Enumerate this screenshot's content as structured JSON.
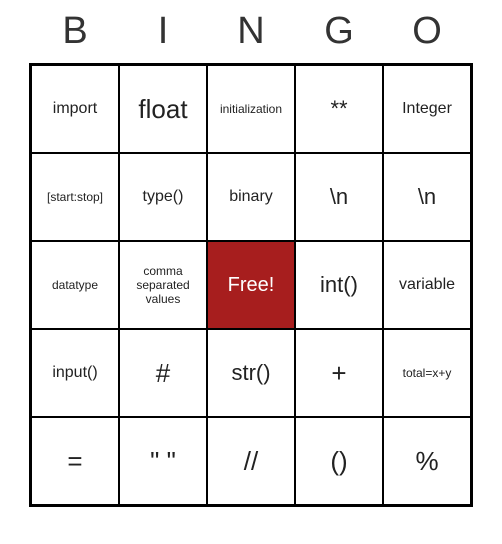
{
  "header": [
    "B",
    "I",
    "N",
    "G",
    "O"
  ],
  "cells": [
    {
      "text": "import",
      "size": "medium"
    },
    {
      "text": "float",
      "size": "xlarge"
    },
    {
      "text": "initialization",
      "size": "small"
    },
    {
      "text": "**",
      "size": "large"
    },
    {
      "text": "Integer",
      "size": "medium"
    },
    {
      "text": "[start:stop]",
      "size": "small"
    },
    {
      "text": "type()",
      "size": "medium"
    },
    {
      "text": "binary",
      "size": "medium"
    },
    {
      "text": "\\n",
      "size": "large"
    },
    {
      "text": "\\n",
      "size": "large"
    },
    {
      "text": "datatype",
      "size": "small"
    },
    {
      "text": "comma separated values",
      "size": "small"
    },
    {
      "text": "Free!",
      "size": "large",
      "free": true
    },
    {
      "text": "int()",
      "size": "large"
    },
    {
      "text": "variable",
      "size": "medium"
    },
    {
      "text": "input()",
      "size": "medium"
    },
    {
      "text": "#",
      "size": "xlarge"
    },
    {
      "text": "str()",
      "size": "large"
    },
    {
      "text": "+",
      "size": "xlarge"
    },
    {
      "text": "total=x+y",
      "size": "small"
    },
    {
      "text": "=",
      "size": "xlarge"
    },
    {
      "text": "\" \"",
      "size": "xlarge"
    },
    {
      "text": "//",
      "size": "xlarge"
    },
    {
      "text": "()",
      "size": "xlarge"
    },
    {
      "text": "%",
      "size": "xlarge"
    }
  ]
}
